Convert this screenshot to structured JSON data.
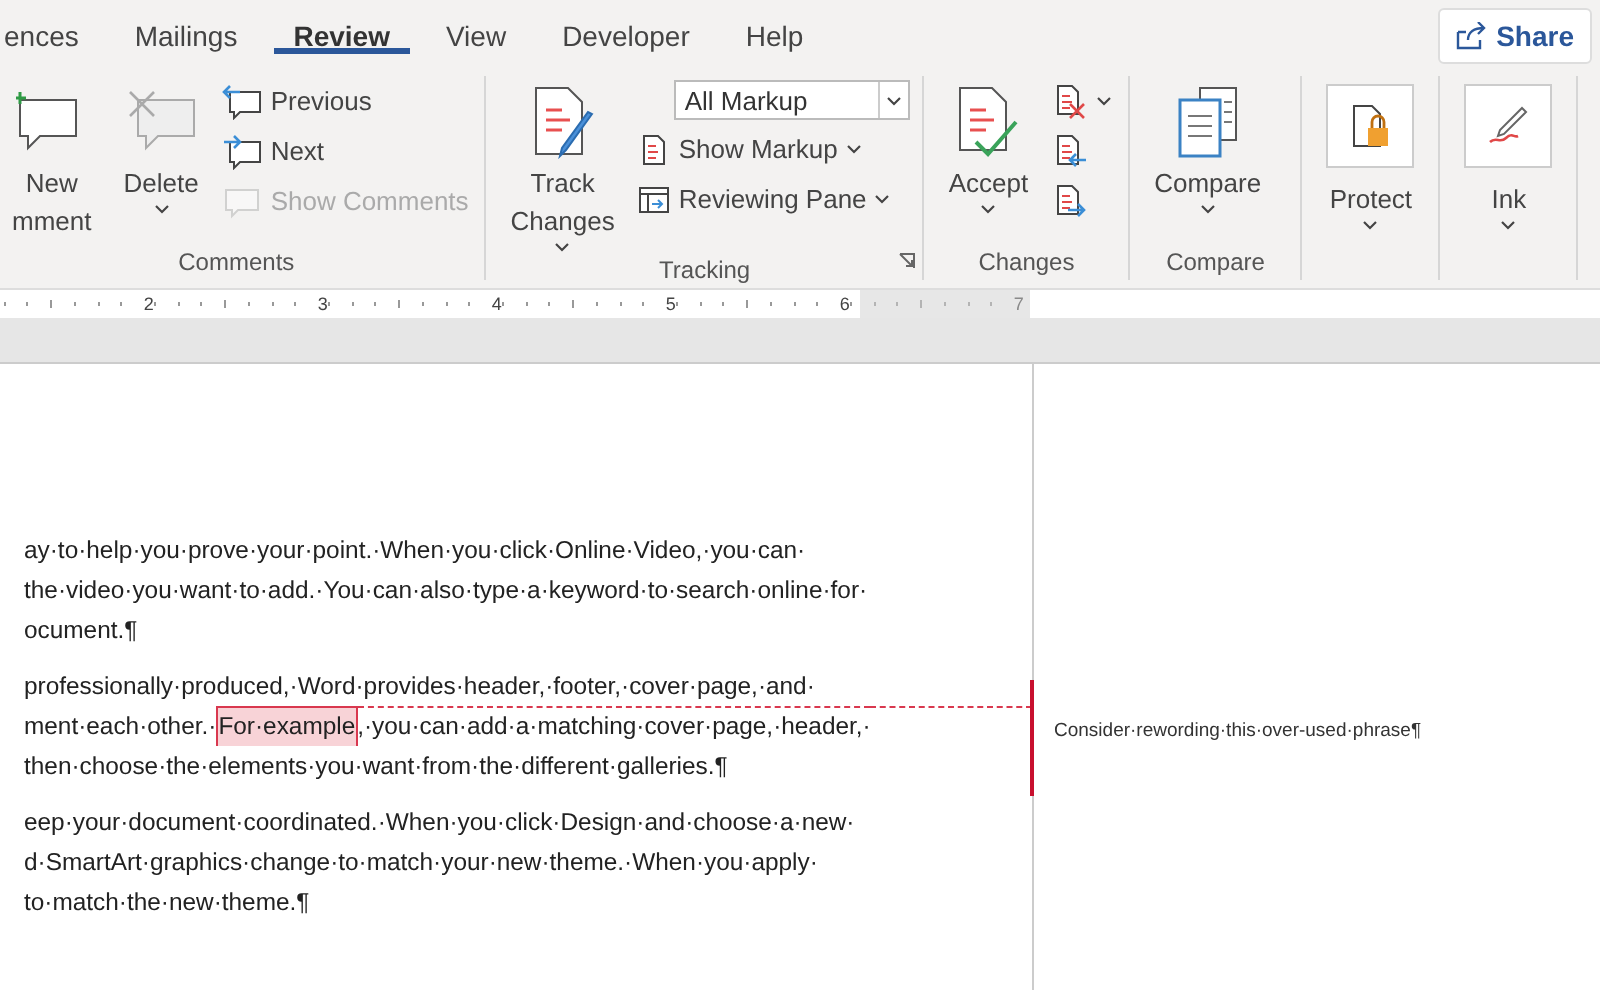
{
  "tabs": [
    {
      "label": "ences",
      "selected": false
    },
    {
      "label": "Mailings",
      "selected": false
    },
    {
      "label": "Review",
      "selected": true
    },
    {
      "label": "View",
      "selected": false
    },
    {
      "label": "Developer",
      "selected": false
    },
    {
      "label": "Help",
      "selected": false
    }
  ],
  "share_button": {
    "label": "Share"
  },
  "ribbon_groups": [
    {
      "label": "Comments",
      "items": [
        {
          "kind": "large",
          "lines": [
            "New",
            "mment"
          ],
          "dropdown": false
        },
        {
          "kind": "large",
          "lines": [
            "Delete"
          ],
          "dropdown": true
        },
        {
          "kind": "stack",
          "items": [
            {
              "kind": "small",
              "label": "Previous",
              "disabled": false,
              "dropdown": false
            },
            {
              "kind": "small",
              "label": "Next",
              "disabled": false,
              "dropdown": false
            },
            {
              "kind": "small",
              "label": "Show Comments",
              "disabled": true,
              "dropdown": false
            }
          ]
        }
      ]
    },
    {
      "label": "Tracking",
      "launcher": true,
      "items": [
        {
          "kind": "large",
          "lines": [
            "Track",
            "Changes"
          ],
          "dropdown": true
        },
        {
          "kind": "stack",
          "items": [
            {
              "kind": "combo",
              "value": "All Markup"
            },
            {
              "kind": "small",
              "label": "Show Markup",
              "disabled": false,
              "dropdown": true
            },
            {
              "kind": "small",
              "label": "Reviewing Pane",
              "disabled": false,
              "dropdown": true
            }
          ]
        }
      ]
    },
    {
      "label": "Changes",
      "launcher": false,
      "items": [
        {
          "kind": "large",
          "lines": [
            "Accept"
          ],
          "dropdown": true
        },
        {
          "kind": "stack",
          "items": [
            {
              "kind": "small",
              "disabled": false,
              "dropdown": true
            },
            {
              "kind": "small",
              "disabled": false,
              "dropdown": false
            },
            {
              "kind": "small",
              "disabled": false,
              "dropdown": false
            }
          ]
        }
      ]
    },
    {
      "label": "Compare",
      "launcher": false,
      "items": [
        {
          "kind": "large",
          "lines": [
            "Compare"
          ],
          "dropdown": true
        }
      ]
    },
    {
      "launcher": false,
      "items": [
        {
          "kind": "large",
          "boxed": true,
          "lines": [
            "Protect"
          ],
          "dropdown": true
        }
      ]
    },
    {
      "launcher": false,
      "items": [
        {
          "kind": "large",
          "boxed": true,
          "lines": [
            "Ink"
          ],
          "dropdown": true
        }
      ]
    }
  ],
  "ruler": {
    "numbers": [
      "2",
      "3",
      "4",
      "5",
      "6",
      "7"
    ]
  },
  "document": {
    "paragraphs": [
      {
        "lines": [
          [
            {
              "text": "ay·to·help·you·prove·your·point.·When·you·click·Online·Video,·you·can·"
            }
          ],
          [
            {
              "text": "the·video·you·want·to·add.·You·can·also·type·a·keyword·to·search·online·for·"
            }
          ],
          [
            {
              "text": "ocument.¶"
            }
          ]
        ]
      },
      {
        "lines": [
          [
            {
              "text": "professionally·produced,·Word·provides·header,·footer,·cover·page,·and·"
            }
          ],
          [
            {
              "text": "ment·each·other.·"
            },
            {
              "text": "For·example",
              "commented": true
            },
            {
              "text": ",·you·can·add·a·matching·cover·page,·header,·"
            }
          ],
          [
            {
              "text": "then·choose·the·elements·you·want·from·the·different·galleries.¶"
            }
          ]
        ]
      },
      {
        "lines": [
          [
            {
              "text": "eep·your·document·coordinated.·When·you·click·Design·and·choose·a·new·"
            }
          ],
          [
            {
              "text": "d·SmartArt·graphics·change·to·match·your·new·theme.·When·you·apply·"
            }
          ],
          [
            {
              "text": "to·match·the·new·theme.¶"
            }
          ]
        ]
      }
    ]
  },
  "comment": {
    "text": "Consider·rewording·this·over-used·phrase¶"
  }
}
